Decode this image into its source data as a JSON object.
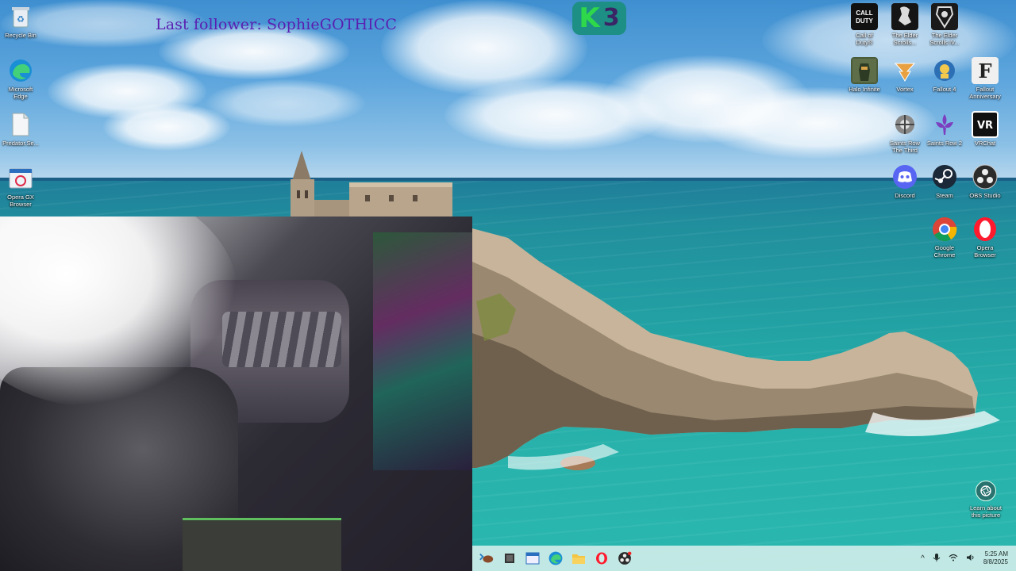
{
  "overlay": {
    "follower_text": "Last follower: SophieGOTHICC",
    "badge_letter": "K",
    "badge_number": "3"
  },
  "desktop_left": [
    {
      "label": "Recycle Bin",
      "icon": "recycle-bin-icon"
    },
    {
      "label": "Microsoft\nEdge",
      "icon": "edge-icon"
    },
    {
      "label": "Predator.Se...",
      "icon": "file-icon"
    },
    {
      "label": "Opera GX\nBrowser",
      "icon": "opera-gx-icon"
    }
  ],
  "desktop_right": [
    {
      "label": "Call of\nDuty®",
      "icon": "call-of-duty-icon"
    },
    {
      "label": "The Elder\nScrolls...",
      "icon": "elder-scrolls-icon"
    },
    {
      "label": "The Elder\nScrolls IV...",
      "icon": "elder-scrolls-iv-icon"
    },
    {
      "label": "Halo Infinite",
      "icon": "halo-infinite-icon"
    },
    {
      "label": "Vortex",
      "icon": "vortex-icon"
    },
    {
      "label": "Fallout 4",
      "icon": "fallout-4-icon"
    },
    {
      "label": "Fallout\nAnniversary",
      "icon": "fallout-anniversary-icon"
    },
    {
      "label": "Saints Row\nThe Third",
      "icon": "saints-row-third-icon"
    },
    {
      "label": "Saints Row 2",
      "icon": "saints-row-2-icon"
    },
    {
      "label": "VRChat",
      "icon": "vrchat-icon"
    },
    {
      "label": "Discord",
      "icon": "discord-icon"
    },
    {
      "label": "Steam",
      "icon": "steam-icon"
    },
    {
      "label": "OBS Studio",
      "icon": "obs-icon"
    },
    {
      "label": "Google\nChrome",
      "icon": "chrome-icon"
    },
    {
      "label": "Opera\nBrowser",
      "icon": "opera-icon"
    }
  ],
  "learn_picture": {
    "label": "Learn about\nthis picture",
    "icon": "camera-icon"
  },
  "taskbar": {
    "apps": [
      "widgets-icon",
      "task-view-icon",
      "window-app-icon",
      "edge-icon",
      "file-explorer-icon",
      "opera-icon",
      "obs-icon"
    ],
    "tray": {
      "chevron": "^",
      "time": "5:25 AM",
      "date": "8/8/2025"
    }
  },
  "colors": {
    "follower_text": "#5a1fb0",
    "badge_bg": "#1e8f84",
    "badge_k": "#2ed84a",
    "taskbar_bg": "#ceece8"
  }
}
